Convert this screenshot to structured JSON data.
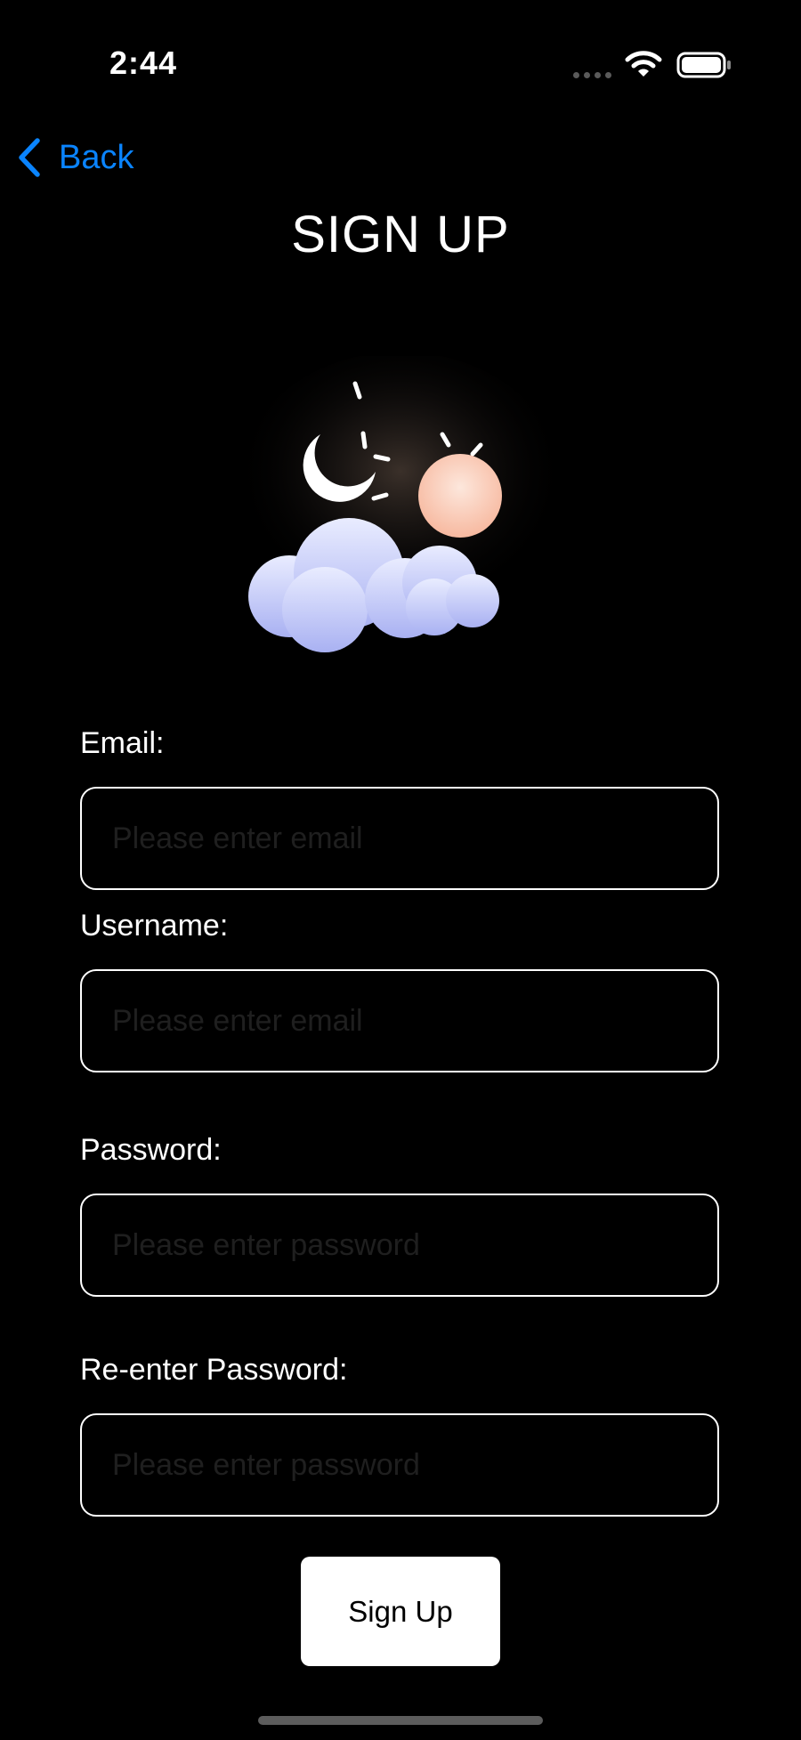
{
  "status_bar": {
    "time": "2:44",
    "icons": [
      "signal-dots-icon",
      "wifi-icon",
      "battery-icon"
    ]
  },
  "nav": {
    "back_label": "Back",
    "back_icon": "chevron-left-icon"
  },
  "page": {
    "title": "SIGN UP",
    "logo_icon": "moon-sun-cloud-logo"
  },
  "form": {
    "email": {
      "label": "Email:",
      "placeholder": "Please enter email",
      "value": ""
    },
    "username": {
      "label": "Username:",
      "placeholder": "Please enter email",
      "value": ""
    },
    "password": {
      "label": "Password:",
      "placeholder": "Please enter password",
      "value": ""
    },
    "reenter_password": {
      "label": "Re-enter Password:",
      "placeholder": "Please enter password",
      "value": ""
    },
    "submit_label": "Sign Up"
  },
  "colors": {
    "background": "#000000",
    "accent": "#0a84ff",
    "text": "#ffffff",
    "button_bg": "#ffffff"
  }
}
